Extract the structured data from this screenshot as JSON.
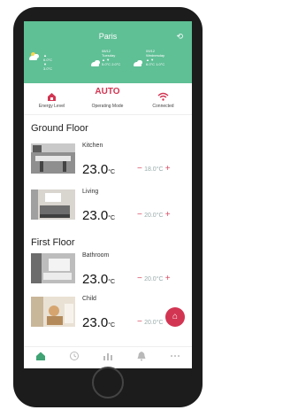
{
  "weather": {
    "city": "Paris",
    "today_temps": [
      "6.0°C",
      "3.0°C"
    ],
    "tue": {
      "date": "08/12",
      "day": "Tuesday",
      "temps": [
        "5.0°C",
        "2.0°C"
      ]
    },
    "wed": {
      "date": "09/12",
      "day": "Wednesday",
      "temps": [
        "6.0°C",
        "1.0°C"
      ]
    }
  },
  "status": {
    "energy_label": "Energy Level",
    "mode_value": "AUTO",
    "mode_label": "Operating Mode",
    "conn_label": "Connected"
  },
  "floors": [
    {
      "name": "Ground Floor",
      "rooms": [
        {
          "name": "Kitchen",
          "temp": "23.0",
          "unit": "°C",
          "setpoint": "18.0",
          "sp_unit": "°C"
        },
        {
          "name": "Living",
          "temp": "23.0",
          "unit": "°C",
          "setpoint": "20.0",
          "sp_unit": "°C"
        }
      ]
    },
    {
      "name": "First Floor",
      "rooms": [
        {
          "name": "Bathroom",
          "temp": "23.0",
          "unit": "°C",
          "setpoint": "20.0",
          "sp_unit": "°C"
        },
        {
          "name": "Child",
          "temp": "23.0",
          "unit": "°C",
          "setpoint": "20.0",
          "sp_unit": "°C"
        }
      ]
    }
  ],
  "controls": {
    "minus": "−",
    "plus": "+"
  },
  "tabs": [
    "home-icon",
    "history-icon",
    "stats-icon",
    "bell-icon",
    "more-icon"
  ],
  "colors": {
    "accent": "#5fbf95",
    "brand": "#d23552"
  }
}
